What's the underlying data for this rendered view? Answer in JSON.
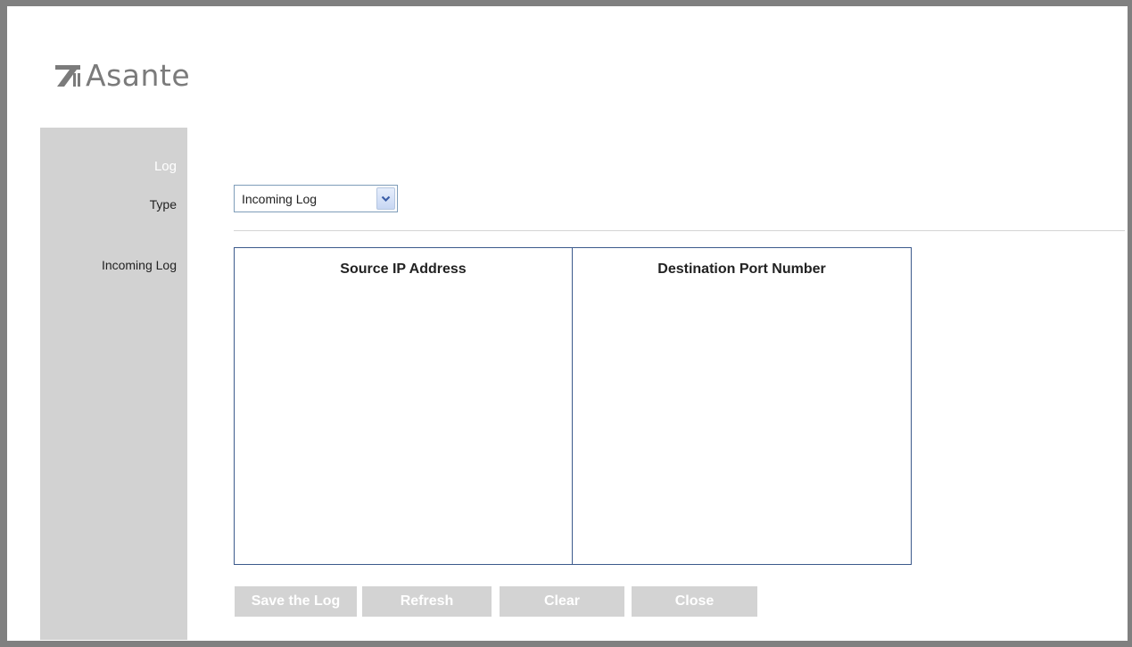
{
  "brand": {
    "name": "Asante",
    "logo_icon": "asante-logo-mark"
  },
  "sidebar": {
    "heading": "Log",
    "type_label": "Type",
    "incoming_label": "Incoming Log"
  },
  "log_type_select": {
    "selected": "Incoming Log",
    "arrow_icon": "chevron-down-icon"
  },
  "log_table": {
    "columns": [
      "Source IP Address",
      "Destination Port Number"
    ],
    "rows": []
  },
  "buttons": {
    "save": "Save the Log",
    "refresh": "Refresh",
    "clear": "Clear",
    "close": "Close"
  },
  "colors": {
    "frame_border": "#808080",
    "sidebar_bg": "#d2d2d2",
    "button_bg": "#d3d3d3",
    "table_border": "#3c5a8c",
    "logo_text": "#7b7b7b"
  }
}
